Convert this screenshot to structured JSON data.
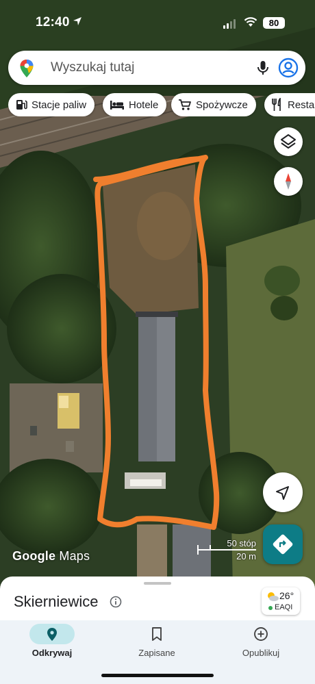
{
  "status_bar": {
    "time": "12:40",
    "battery": "80"
  },
  "search": {
    "placeholder": "Wyszukaj tutaj"
  },
  "chips": [
    {
      "label": "Stacje paliw",
      "icon": "gas-station-icon"
    },
    {
      "label": "Hotele",
      "icon": "hotel-bed-icon"
    },
    {
      "label": "Spożywcze",
      "icon": "shopping-cart-icon"
    },
    {
      "label": "Restau",
      "icon": "restaurant-icon"
    }
  ],
  "map": {
    "attribution_brand": "Google",
    "attribution_product": "Maps",
    "scale_imperial": "50 stóp",
    "scale_metric": "20 m",
    "annotation_color": "#f07f2e"
  },
  "sheet": {
    "place_title": "Skierniewice",
    "weather_temp": "26°",
    "air_quality": "EAQI"
  },
  "bottom_nav": [
    {
      "label": "Odkrywaj",
      "icon": "explore-pin-icon",
      "active": true
    },
    {
      "label": "Zapisane",
      "icon": "bookmark-icon",
      "active": false
    },
    {
      "label": "Opublikuj",
      "icon": "add-circle-icon",
      "active": false
    }
  ],
  "colors": {
    "accent": "#0d7c86",
    "nav_pill": "#c2e7ec",
    "air_ok": "#34a853"
  }
}
